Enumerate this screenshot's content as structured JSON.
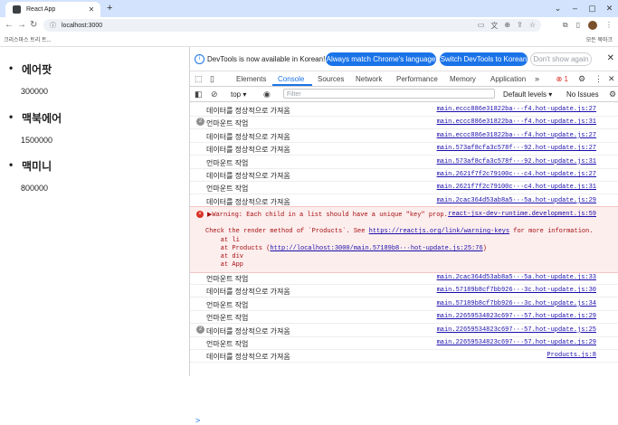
{
  "browser": {
    "tab_title": "React App",
    "url": "localhost:3000",
    "bookmark_left": "크리스마스 트리 트...",
    "bookmark_right": "모든 북마크"
  },
  "page": {
    "products": [
      {
        "name": "에어팟",
        "price": "300000"
      },
      {
        "name": "맥북에어",
        "price": "1500000"
      },
      {
        "name": "맥미니",
        "price": "800000"
      }
    ]
  },
  "devtools": {
    "info_message": "DevTools is now available in Korean!",
    "btn_match": "Always match Chrome's language",
    "btn_switch": "Switch DevTools to Korean",
    "btn_dismiss": "Don't show again",
    "tabs": [
      "Elements",
      "Console",
      "Sources",
      "Network",
      "Performance",
      "Memory",
      "Application"
    ],
    "error_count": "1",
    "context": "top",
    "filter_placeholder": "Filter",
    "levels": "Default levels",
    "issues": "No Issues",
    "console_rows_top": [
      {
        "msg": "데이터를 정상적으로 가져옴",
        "src": "main.eccc886e31822ba···f4.hot-update.js:27",
        "count": ""
      },
      {
        "msg": "언마운트 작업",
        "src": "main.eccc886e31822ba···f4.hot-update.js:31",
        "count": "2"
      },
      {
        "msg": "데이터를 정상적으로 가져옴",
        "src": "main.eccc886e31822ba···f4.hot-update.js:27",
        "count": ""
      },
      {
        "msg": "데이터를 정상적으로 가져옴",
        "src": "main.573af8cfa3c578f···92.hot-update.js:27",
        "count": ""
      },
      {
        "msg": "언마운트 작업",
        "src": "main.573af8cfa3c578f···92.hot-update.js:31",
        "count": ""
      },
      {
        "msg": "데이터를 정상적으로 가져옴",
        "src": "main.2621f7f2c79100c···c4.hot-update.js:27",
        "count": ""
      },
      {
        "msg": "언마운트 작업",
        "src": "main.2621f7f2c79100c···c4.hot-update.js:31",
        "count": ""
      },
      {
        "msg": "데이터를 정상적으로 가져옴",
        "src": "main.2cac364d53ab8a5···5a.hot-update.js:29",
        "count": ""
      }
    ],
    "warning": {
      "line1": "▶Warning: Each child in a list should have a unique \"key\" prop.",
      "src": "react-jsx-dev-runtime.development.js:59",
      "line2a": "Check the render method of `Products`. See ",
      "line2_link": "https://reactjs.org/link/warning-keys",
      "line2b": " for more information.",
      "line3": "    at li",
      "line4a": "    at Products (",
      "line4_link": "http://localhost:3000/main.57189b8···hot-update.js:25:76",
      "line4b": ")",
      "line5": "    at div",
      "line6": "    at App"
    },
    "console_rows_bottom": [
      {
        "msg": "언마운트 작업",
        "src": "main.2cac364d53ab8a5···5a.hot-update.js:33",
        "count": ""
      },
      {
        "msg": "데이터를 정상적으로 가져옴",
        "src": "main.57189b8cf7bb926···3c.hot-update.js:30",
        "count": ""
      },
      {
        "msg": "언마운트 작업",
        "src": "main.57189b8cf7bb926···3c.hot-update.js:34",
        "count": ""
      },
      {
        "msg": "언마운트 작업",
        "src": "main.22659534823c697···57.hot-update.js:29",
        "count": ""
      },
      {
        "msg": "데이터를 정상적으로 가져옴",
        "src": "main.22659534823c697···57.hot-update.js:25",
        "count": "2"
      },
      {
        "msg": "언마운트 작업",
        "src": "main.22659534823c697···57.hot-update.js:29",
        "count": ""
      },
      {
        "msg": "데이터를 정상적으로 가져옴",
        "src": "Products.js:8",
        "count": ""
      }
    ],
    "prompt": ">"
  },
  "colors": {
    "accent": "#1a73e8",
    "error": "#d93025",
    "warning_bg": "#fdeeee"
  }
}
